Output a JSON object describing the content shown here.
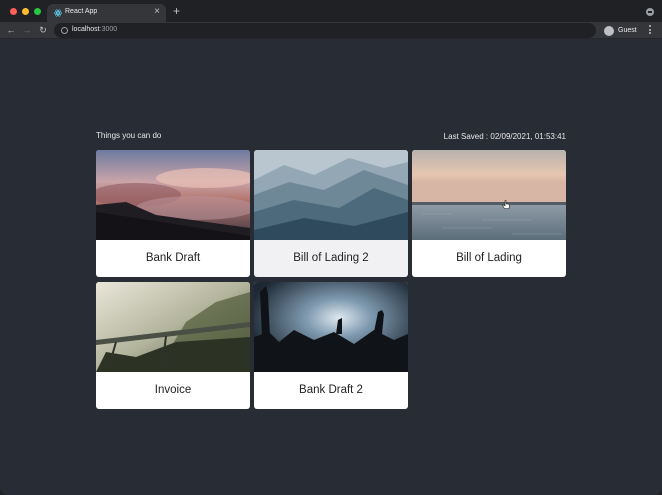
{
  "browser": {
    "tab_title": "React App",
    "tab_close": "×",
    "new_tab": "+",
    "url_host": "localhost",
    "url_port": ":3000",
    "profile_label": "Guest",
    "back": "←",
    "forward": "→",
    "reload": "↻"
  },
  "page": {
    "heading": "Things you can do",
    "last_saved": "Last Saved : 02/09/2021, 01:53:41"
  },
  "cards": [
    {
      "title": "Bank Draft",
      "image": "sunset-clouds-mountain"
    },
    {
      "title": "Bill of Lading 2",
      "image": "blue-mountain-ridges"
    },
    {
      "title": "Bill of Lading",
      "image": "sea-horizon-dusk"
    },
    {
      "title": "Invoice",
      "image": "misty-forest-bridge"
    },
    {
      "title": "Bank Draft 2",
      "image": "concert-crowd"
    }
  ],
  "colors": {
    "page_bg": "#282c34",
    "card_bg": "#ffffff",
    "card_title": "#222222"
  }
}
